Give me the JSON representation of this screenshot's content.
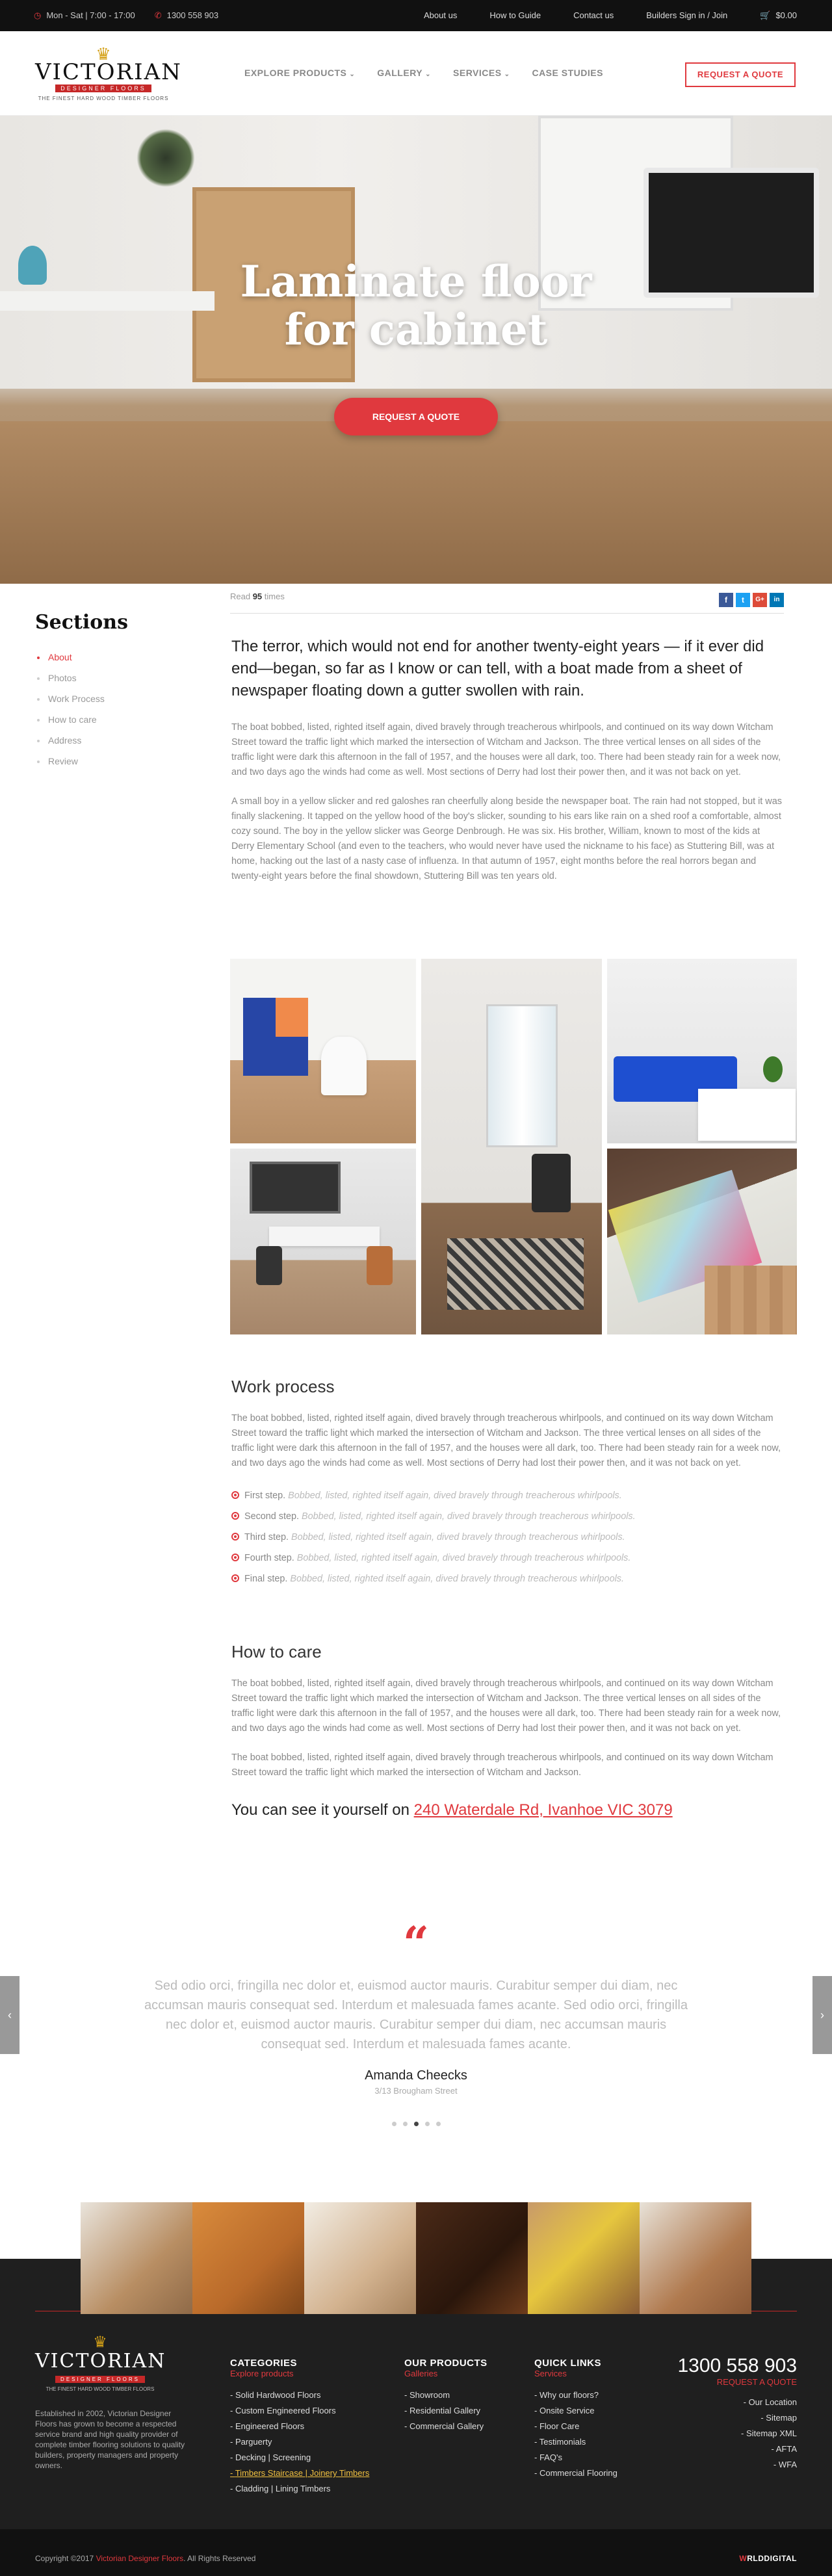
{
  "topbar": {
    "hours": "Mon - Sat | 7:00 - 17:00",
    "phone": "1300 558 903",
    "links": [
      "About us",
      "How to Guide",
      "Contact us",
      "Builders Sign in / Join"
    ],
    "cart_total": "$0.00"
  },
  "logo": {
    "name": "VICTORIAN",
    "sub": "DESIGNER FLOORS",
    "tagline": "THE FINEST HARD WOOD TIMBER FLOORS"
  },
  "nav": [
    "EXPLORE PRODUCTS",
    "GALLERY",
    "SERVICES",
    "CASE STUDIES"
  ],
  "header": {
    "quote_label": "REQUEST A QUOTE"
  },
  "hero": {
    "title_line1": "Laminate floor",
    "title_line2": "for cabinet",
    "cta": "REQUEST A QUOTE"
  },
  "readbar": {
    "read_prefix": "Read",
    "read_count": "95",
    "read_suffix": "times"
  },
  "share": [
    "f",
    "t",
    "G+",
    "in"
  ],
  "sidebar": {
    "title": "Sections",
    "items": [
      "About",
      "Photos",
      "Work Process",
      "How to care",
      "Address",
      "Review"
    ]
  },
  "article": {
    "lead": "The terror, which would not end for another twenty-eight years — if it ever did end—began, so far as I know or can tell, with a boat made from a sheet of newspaper floating down a gutter swollen with rain.",
    "p1": "The boat bobbed, listed, righted itself again, dived bravely through treacherous whirlpools, and continued on its way down Witcham Street toward the traffic light which marked the intersection of Witcham and Jackson. The three vertical lenses on all sides of the traffic light were dark this afternoon in the fall of 1957, and the houses were all dark, too. There had been steady rain for a week now, and two days ago the winds had come as well. Most sections of Derry had lost their power then, and it was not back on yet.",
    "p2": "A small boy in a yellow slicker and red galoshes ran cheerfully along beside the newspaper boat. The rain had not stopped, but it was finally slackening. It tapped on the yellow hood of the boy's slicker, sounding to his ears like rain on a shed roof a comfortable, almost cozy sound. The boy in the yellow slicker was George Denbrough. He was six. His brother, William, known to most of the kids at Derry Elementary School (and even to the teachers, who would never have used the nickname to his face) as Stuttering Bill, was at home, hacking out the last of a nasty case of influenza. In that autumn of 1957, eight months before the real horrors began and twenty-eight years before the final showdown, Stuttering Bill was ten years old.",
    "work_title": "Work process",
    "p3": "The boat bobbed, listed, righted itself again, dived bravely through treacherous whirlpools, and continued on its way down Witcham Street toward the traffic light which marked the intersection of Witcham and Jackson. The three vertical lenses on all sides of the traffic light were dark this afternoon in the fall of 1957, and the houses were all dark, too. There had been steady rain for a week now, and two days ago the winds had come as well. Most sections of Derry had lost their power then, and it was not back on yet.",
    "steps": [
      {
        "label": "First step.",
        "text": "Bobbed, listed, righted itself again, dived bravely through treacherous whirlpools."
      },
      {
        "label": "Second step.",
        "text": "Bobbed, listed, righted itself again, dived bravely through treacherous whirlpools."
      },
      {
        "label": "Third step.",
        "text": "Bobbed, listed, righted itself again, dived bravely through treacherous whirlpools."
      },
      {
        "label": "Fourth step.",
        "text": "Bobbed, listed, righted itself again, dived bravely through treacherous whirlpools."
      },
      {
        "label": "Final step.",
        "text": "Bobbed, listed, righted itself again, dived bravely through treacherous whirlpools."
      }
    ],
    "care_title": "How to care",
    "p4": "The boat bobbed, listed, righted itself again, dived bravely through treacherous whirlpools, and continued on its way down Witcham Street toward the traffic light which marked the intersection of Witcham and Jackson. The three vertical lenses on all sides of the traffic light were dark this afternoon in the fall of 1957, and the houses were all dark, too. There had been steady rain for a week now, and two days ago the winds had come as well. Most sections of Derry had lost their power then, and it was not back on yet.",
    "p5": "The boat bobbed, listed, righted itself again, dived bravely through treacherous whirlpools, and continued on its way down Witcham Street toward the traffic light which marked the intersection of Witcham and Jackson.",
    "see_prefix": "You can see it yourself on",
    "address": "240 Waterdale Rd, Ivanhoe VIC 3079"
  },
  "testimonial": {
    "quote": "Sed odio orci, fringilla nec dolor et, euismod auctor mauris. Curabitur semper dui diam, nec accumsan mauris consequat sed. Interdum et malesuada fames acante. Sed odio orci, fringilla nec dolor et, euismod auctor mauris. Curabitur semper dui diam, nec accumsan mauris consequat sed. Interdum et malesuada fames acante.",
    "name": "Amanda Cheecks",
    "address": "3/13 Brougham Street",
    "active_index": 2
  },
  "footer": {
    "description": "Established in 2002, Victorian Designer Floors has grown to become a respected service brand and high quality provider of complete timber flooring solutions to quality builders, property managers and property owners.",
    "categories": {
      "title": "CATEGORIES",
      "sub": "Explore products",
      "items": [
        "Solid Hardwood Floors",
        "Custom Engineered Floors",
        "Engineered Floors",
        "Parguerty",
        "Decking | Screening",
        "Timbers Staircase | Joinery Timbers",
        "Cladding | Lining Timbers"
      ]
    },
    "products": {
      "title": "OUR PRODUCTS",
      "sub": "Galleries",
      "items": [
        "Showroom",
        "Residential Gallery",
        "Commercial Gallery"
      ]
    },
    "quick": {
      "title": "QUICK LINKS",
      "sub": "Services",
      "items": [
        "Why our floors?",
        "Onsite Service",
        "Floor Care",
        "Testimonials",
        "FAQ's",
        "Commercial Flooring"
      ]
    },
    "contact": {
      "phone": "1300 558 903",
      "request": "REQUEST A QUOTE",
      "items": [
        "Our Location",
        "Sitemap",
        "Sitemap XML",
        "AFTA",
        "WFA"
      ]
    },
    "copyright_prefix": "Copyright ©2017",
    "copyright_brand": "Victorian Designer Floors",
    "copyright_suffix": ". All Rights Reserved",
    "credit_a": "W",
    "credit_b": "RLDDIGITAL"
  },
  "colors": {
    "accent": "#e0393e",
    "dark": "#1f1f1f",
    "topbar": "#111111"
  }
}
